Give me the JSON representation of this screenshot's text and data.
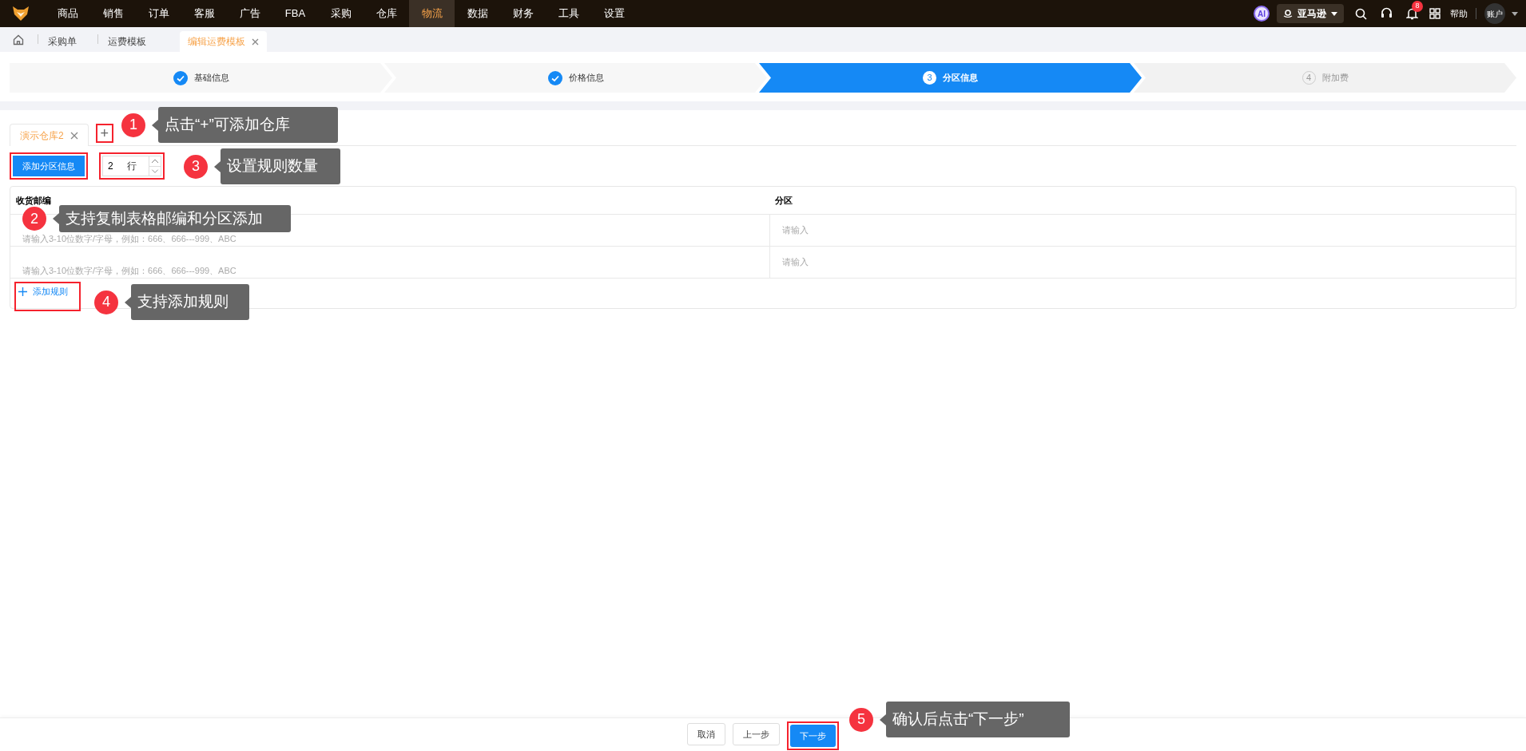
{
  "top_nav": {
    "items": [
      {
        "label": "商品",
        "selected": false
      },
      {
        "label": "销售",
        "selected": false
      },
      {
        "label": "订单",
        "selected": false
      },
      {
        "label": "客服",
        "selected": false
      },
      {
        "label": "广告",
        "selected": false
      },
      {
        "label": "FBA",
        "selected": false
      },
      {
        "label": "采购",
        "selected": false
      },
      {
        "label": "仓库",
        "selected": false
      },
      {
        "label": "物流",
        "selected": true
      },
      {
        "label": "数据",
        "selected": false
      },
      {
        "label": "财务",
        "selected": false
      },
      {
        "label": "工具",
        "selected": false
      },
      {
        "label": "设置",
        "selected": false
      }
    ],
    "ai_badge": "AI",
    "marketplace": "亚马逊",
    "notification_count": "8",
    "help": "帮助",
    "account": "账户"
  },
  "breadcrumb_tabs": [
    {
      "label": "采购单",
      "selected": false,
      "closable": false
    },
    {
      "label": "运费模板",
      "selected": false,
      "closable": false
    },
    {
      "label": "编辑运费模板",
      "selected": true,
      "closable": true
    }
  ],
  "steps": [
    {
      "label": "基础信息",
      "completed": true,
      "selected": false
    },
    {
      "label": "价格信息",
      "completed": true,
      "selected": false
    },
    {
      "number": "3",
      "label": "分区信息",
      "completed": false,
      "selected": true
    },
    {
      "number": "4",
      "label": "附加费",
      "completed": false,
      "selected": false
    }
  ],
  "warehouse_tabs": [
    {
      "label": "演示仓库2",
      "selected": true
    }
  ],
  "add_warehouse": "+",
  "add_zone_button": "添加分区信息",
  "row_count": {
    "value": "2",
    "unit": "行"
  },
  "table": {
    "columns": [
      "收货邮编",
      "分区"
    ],
    "rows": [
      {
        "postcode_placeholder": "请输入3-10位数字/字母，例如：666、666---999、ABC",
        "zone_placeholder": "请输入"
      },
      {
        "postcode_placeholder": "请输入3-10位数字/字母，例如：666、666---999、ABC",
        "zone_placeholder": "请输入"
      }
    ],
    "add_rule": "添加规则"
  },
  "footer_buttons": [
    {
      "label": "取消",
      "kind": "default"
    },
    {
      "label": "上一步",
      "kind": "default"
    },
    {
      "label": "下一步",
      "kind": "primary"
    }
  ],
  "annotations": [
    {
      "number": "1",
      "text": "点击“+”可添加仓库"
    },
    {
      "number": "2",
      "text": "支持复制表格邮编和分区添加"
    },
    {
      "number": "3",
      "text": "设置规则数量"
    },
    {
      "number": "4",
      "text": "支持添加规则"
    },
    {
      "number": "5",
      "text": "确认后点击“下一步”"
    }
  ]
}
